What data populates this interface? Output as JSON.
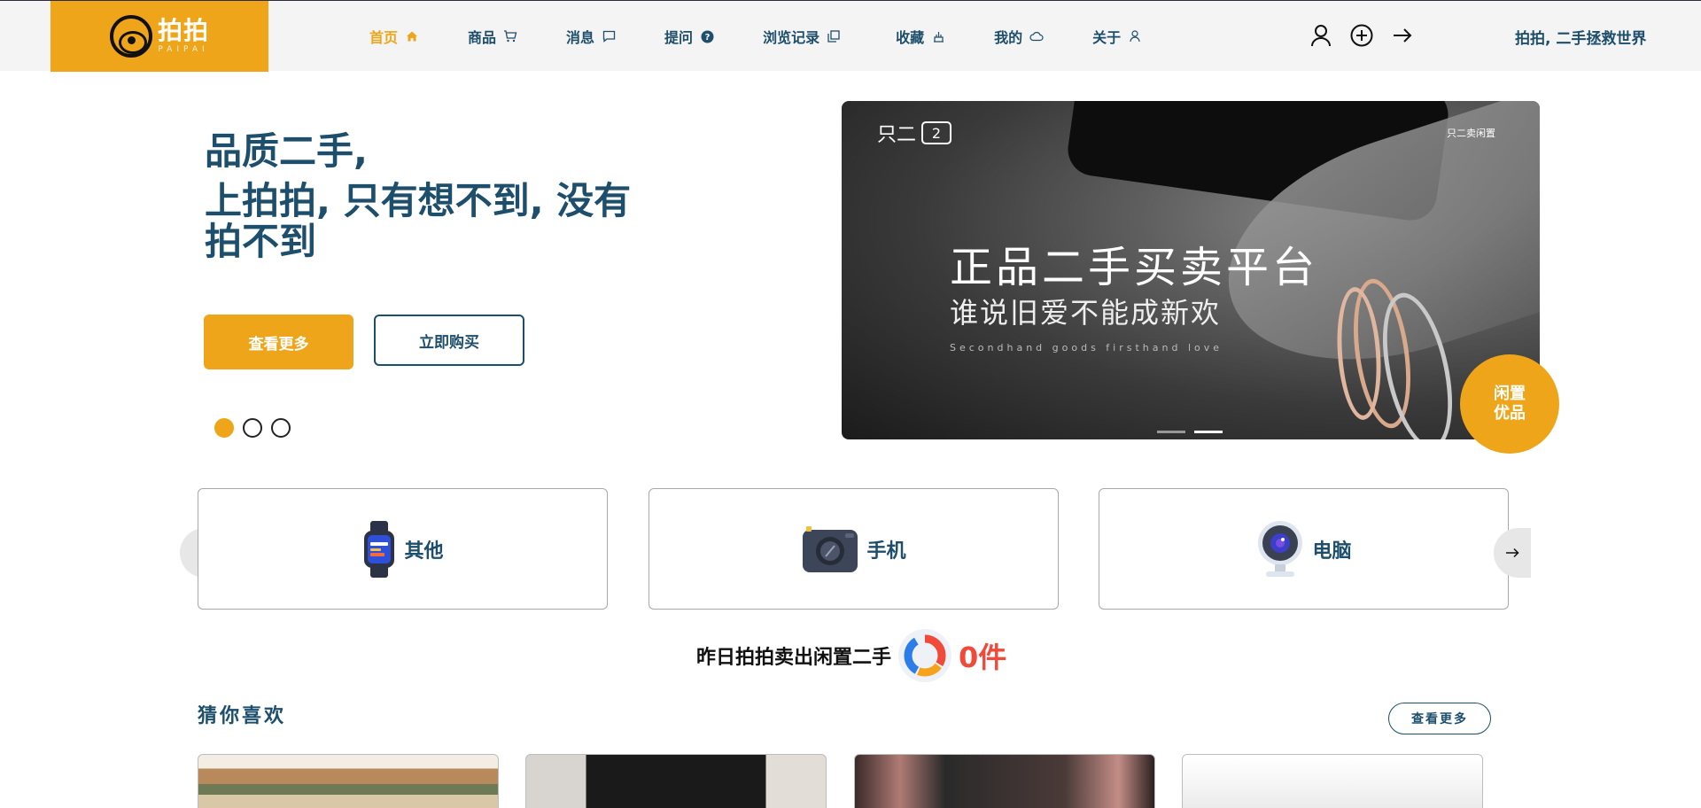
{
  "brand": {
    "name": "拍拍",
    "subtitle": "PAIPAI",
    "color": "#eea519"
  },
  "nav": [
    {
      "label": "首页",
      "icon": "home-icon",
      "active": true
    },
    {
      "label": "商品",
      "icon": "cart-icon"
    },
    {
      "label": "消息",
      "icon": "message-icon"
    },
    {
      "label": "提问",
      "icon": "question-icon"
    },
    {
      "label": "浏览记录",
      "icon": "history-icon"
    },
    {
      "label": "收藏",
      "icon": "favorite-icon"
    },
    {
      "label": "我的",
      "icon": "cloud-icon"
    },
    {
      "label": "关于",
      "icon": "user-outline-icon"
    }
  ],
  "header_icons": [
    "user-icon",
    "plus-circle-icon",
    "arrow-right-icon"
  ],
  "slogan": "拍拍, 二手拯救世界",
  "hero": {
    "line1": "品质二手,",
    "line2": "上拍拍, 只有想不到, 没有拍不到",
    "primary_button": "查看更多",
    "secondary_button": "立即购买",
    "dots_count": 3,
    "active_dot": 0
  },
  "banner": {
    "brand": "只二",
    "brand_box": "2",
    "corner": "只二卖闲置",
    "headline": "正品二手买卖平台",
    "subheadline": "谁说旧爱不能成新欢",
    "english": "Secondhand goods firsthand love",
    "badge": "闲置\n优品"
  },
  "categories": [
    {
      "label": "其他",
      "icon": "smartwatch-icon"
    },
    {
      "label": "手机",
      "icon": "camera-icon"
    },
    {
      "label": "电脑",
      "icon": "webcam-icon"
    }
  ],
  "sold": {
    "text": "昨日拍拍卖出闲置二手",
    "count": "0件"
  },
  "guess": {
    "title": "猜你喜欢",
    "more": "查看更多"
  }
}
